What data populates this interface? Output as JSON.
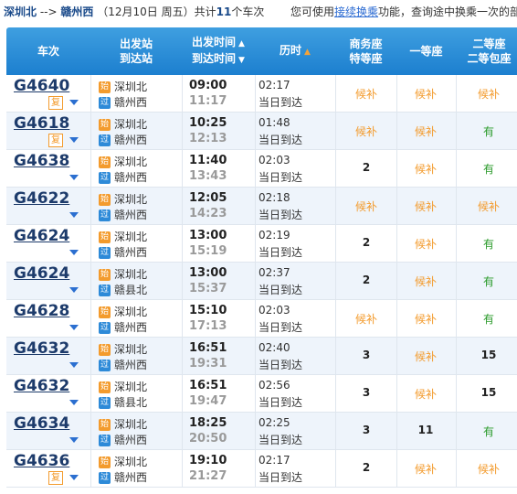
{
  "summary": {
    "from": "深圳北",
    "arrow": "-->",
    "to": "赣州西",
    "date": "（12月10日  周五）",
    "count_prefix": "共计",
    "count": "11",
    "count_suffix": "个车次",
    "tip_prefix": "您可使用",
    "tip_link": "接续换乘",
    "tip_suffix": "功能，查询途中换乘一次的部"
  },
  "header": {
    "train": "车次",
    "stations_1": "出发站",
    "stations_2": "到达站",
    "times_1": "出发时间",
    "times_2": "到达时间",
    "duration": "历时",
    "business_1": "商务座",
    "business_2": "特等座",
    "first": "一等座",
    "second_1": "二等座",
    "second_2": "二等包座"
  },
  "icons": {
    "start": "始",
    "pass": "过",
    "fu": "复",
    "sort_up": "▲",
    "sort_down": "▼"
  },
  "rows": [
    {
      "train": "G4640",
      "fu": true,
      "from": "深圳北",
      "from_type": "start",
      "to": "赣州西",
      "to_type": "pass",
      "dep": "09:00",
      "arr": "11:17",
      "dur": "02:17",
      "day": "当日到达",
      "business": "候补",
      "first": "候补",
      "second": "候补"
    },
    {
      "train": "G4618",
      "fu": true,
      "from": "深圳北",
      "from_type": "start",
      "to": "赣州西",
      "to_type": "pass",
      "dep": "10:25",
      "arr": "12:13",
      "dur": "01:48",
      "day": "当日到达",
      "business": "候补",
      "first": "候补",
      "second": "有"
    },
    {
      "train": "G4638",
      "fu": false,
      "from": "深圳北",
      "from_type": "start",
      "to": "赣州西",
      "to_type": "pass",
      "dep": "11:40",
      "arr": "13:43",
      "dur": "02:03",
      "day": "当日到达",
      "business": "2",
      "first": "候补",
      "second": "有"
    },
    {
      "train": "G4622",
      "fu": false,
      "from": "深圳北",
      "from_type": "start",
      "to": "赣州西",
      "to_type": "pass",
      "dep": "12:05",
      "arr": "14:23",
      "dur": "02:18",
      "day": "当日到达",
      "business": "候补",
      "first": "候补",
      "second": "候补"
    },
    {
      "train": "G4624",
      "fu": false,
      "from": "深圳北",
      "from_type": "start",
      "to": "赣州西",
      "to_type": "pass",
      "dep": "13:00",
      "arr": "15:19",
      "dur": "02:19",
      "day": "当日到达",
      "business": "2",
      "first": "候补",
      "second": "有"
    },
    {
      "train": "G4624",
      "fu": false,
      "from": "深圳北",
      "from_type": "start",
      "to": "赣县北",
      "to_type": "pass",
      "dep": "13:00",
      "arr": "15:37",
      "dur": "02:37",
      "day": "当日到达",
      "business": "2",
      "first": "候补",
      "second": "有"
    },
    {
      "train": "G4628",
      "fu": false,
      "from": "深圳北",
      "from_type": "start",
      "to": "赣州西",
      "to_type": "pass",
      "dep": "15:10",
      "arr": "17:13",
      "dur": "02:03",
      "day": "当日到达",
      "business": "候补",
      "first": "候补",
      "second": "有"
    },
    {
      "train": "G4632",
      "fu": false,
      "from": "深圳北",
      "from_type": "start",
      "to": "赣州西",
      "to_type": "pass",
      "dep": "16:51",
      "arr": "19:31",
      "dur": "02:40",
      "day": "当日到达",
      "business": "3",
      "first": "候补",
      "second": "15"
    },
    {
      "train": "G4632",
      "fu": false,
      "from": "深圳北",
      "from_type": "start",
      "to": "赣县北",
      "to_type": "pass",
      "dep": "16:51",
      "arr": "19:47",
      "dur": "02:56",
      "day": "当日到达",
      "business": "3",
      "first": "候补",
      "second": "15"
    },
    {
      "train": "G4634",
      "fu": false,
      "from": "深圳北",
      "from_type": "start",
      "to": "赣州西",
      "to_type": "pass",
      "dep": "18:25",
      "arr": "20:50",
      "dur": "02:25",
      "day": "当日到达",
      "business": "3",
      "first": "11",
      "second": "有"
    },
    {
      "train": "G4636",
      "fu": true,
      "from": "深圳北",
      "from_type": "start",
      "to": "赣州西",
      "to_type": "pass",
      "dep": "19:10",
      "arr": "21:27",
      "dur": "02:17",
      "day": "当日到达",
      "business": "2",
      "first": "候补",
      "second": "候补"
    }
  ]
}
